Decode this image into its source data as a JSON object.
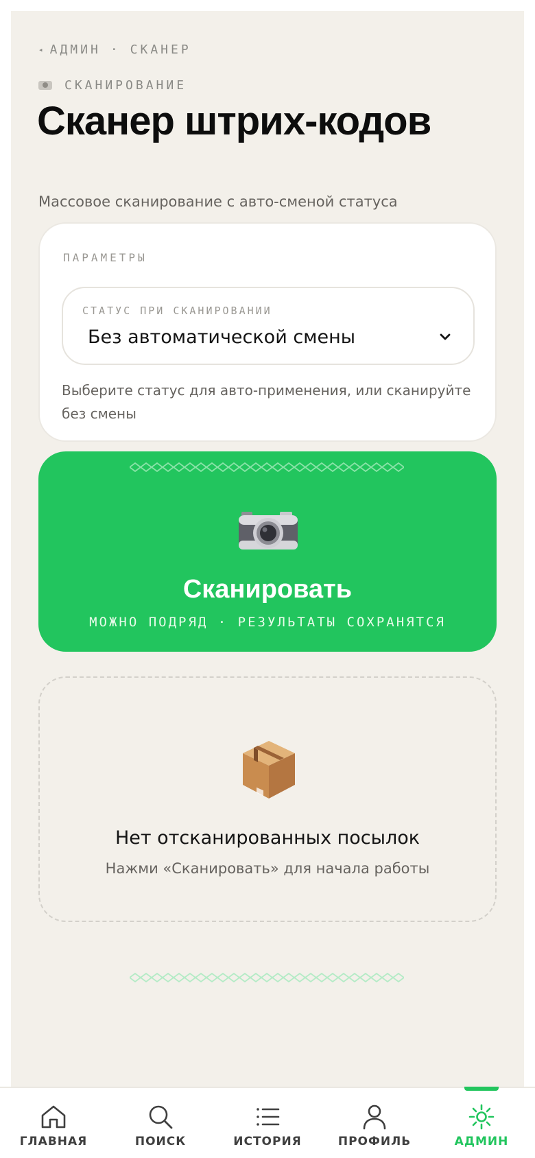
{
  "breadcrumb": {
    "root": "АДМИН",
    "separator": "·",
    "current": "СКАНЕР"
  },
  "section": {
    "kicker": "СКАНИРОВАНИЕ",
    "icon": "camera-icon"
  },
  "header": {
    "title": "Сканер штрих-кодов",
    "subtitle": "Массовое сканирование с авто-сменой статуса"
  },
  "params": {
    "label": "ПАРАМЕТРЫ",
    "status_select": {
      "caption": "СТАТУС ПРИ СКАНИРОВАНИИ",
      "value": "Без автоматической смены",
      "icon": "chevron-down-icon"
    },
    "hint": "Выберите статус для авто-применения, или сканируйте без смены"
  },
  "scan": {
    "label": "Сканировать",
    "sublabel": "МОЖНО ПОДРЯД · РЕЗУЛЬТАТЫ СОХРАНЯТСЯ",
    "icon": "camera-icon"
  },
  "empty": {
    "title": "Нет отсканированных посылок",
    "subtitle": "Нажми «Сканировать» для начала работы",
    "icon": "package-icon"
  },
  "tabbar": {
    "items": [
      {
        "label": "ГЛАВНАЯ",
        "icon": "home-icon",
        "active": false
      },
      {
        "label": "ПОИСК",
        "icon": "search-icon",
        "active": false
      },
      {
        "label": "ИСТОРИЯ",
        "icon": "list-icon",
        "active": false
      },
      {
        "label": "ПРОФИЛЬ",
        "icon": "user-icon",
        "active": false
      },
      {
        "label": "АДМИН",
        "icon": "sun-gear-icon",
        "active": true
      }
    ]
  },
  "colors": {
    "accent": "#22c55e",
    "background": "#f3f0ea",
    "card": "#ffffff",
    "muted_text": "#8a8a86",
    "body_text": "#66635f"
  }
}
